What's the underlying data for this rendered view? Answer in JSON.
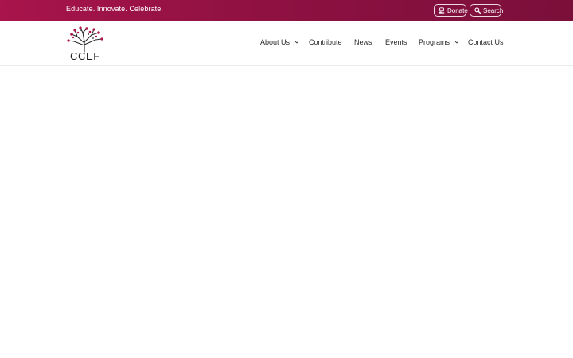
{
  "topbar": {
    "tagline": "Educate. Innovate. Celebrate.",
    "donate_label": "Donate",
    "search_label": "Search",
    "gradient_start": "#a8144b",
    "gradient_end": "#7a0f3a"
  },
  "logo": {
    "text": "CCEF",
    "leaf_color": "#b0154a"
  },
  "nav": {
    "items": [
      {
        "label": "About Us",
        "has_dropdown": true
      },
      {
        "label": "Contribute",
        "has_dropdown": false
      },
      {
        "label": "News",
        "has_dropdown": false
      },
      {
        "label": "Events",
        "has_dropdown": false
      },
      {
        "label": "Programs",
        "has_dropdown": true
      },
      {
        "label": "Contact Us",
        "has_dropdown": false
      }
    ]
  },
  "icons": {
    "donate": "donate-hand-icon",
    "search": "search-icon",
    "dropdown": "chevron-down-icon"
  }
}
